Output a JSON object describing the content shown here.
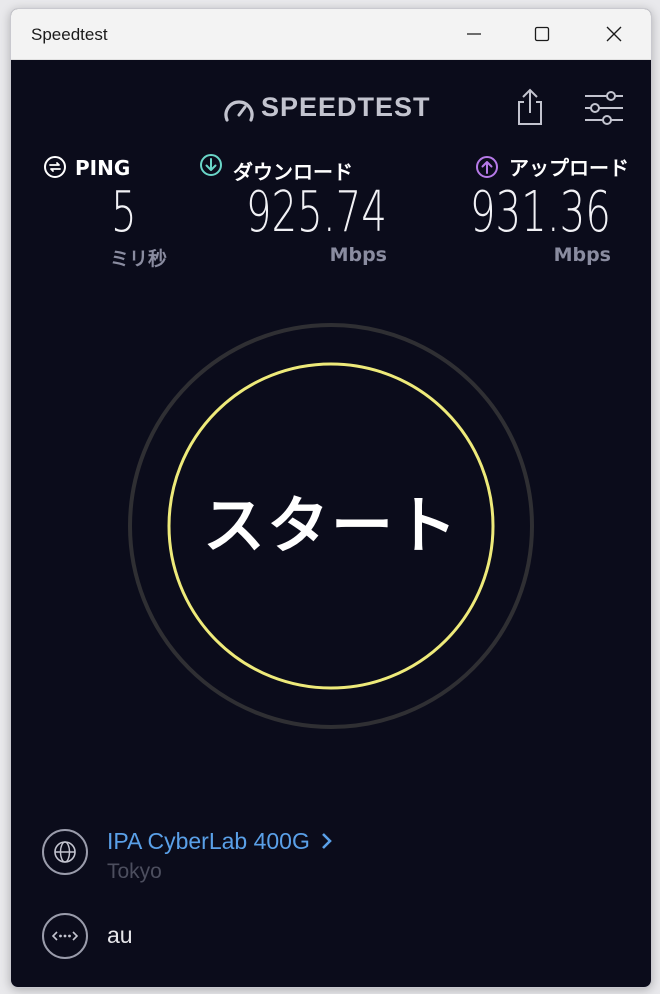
{
  "window": {
    "title": "Speedtest"
  },
  "header": {
    "logo_text": "SPEEDTEST",
    "icons": [
      "speedometer-logo-icon",
      "share-icon",
      "settings-sliders-icon"
    ]
  },
  "metrics": {
    "ping": {
      "label": "PING",
      "value": "5",
      "unit": "ミリ秒",
      "icon": "ping-icon",
      "color": "#ffffff"
    },
    "download": {
      "label": "ダウンロード",
      "value": "925.74",
      "unit": "Mbps",
      "icon": "download-arrow-icon",
      "color": "#6ad6c8"
    },
    "upload": {
      "label": "アップロード",
      "value": "931.36",
      "unit": "Mbps",
      "icon": "upload-arrow-icon",
      "color": "#b67ae8"
    }
  },
  "start": {
    "label": "スタート",
    "ring_color": "#eeea7a",
    "outer_ring_color": "#2f2f33"
  },
  "server": {
    "name": "IPA CyberLab 400G",
    "location": "Tokyo",
    "icon": "globe-icon",
    "link_color": "#5aa0e8"
  },
  "isp": {
    "name": "au",
    "icon": "connection-dots-icon"
  }
}
